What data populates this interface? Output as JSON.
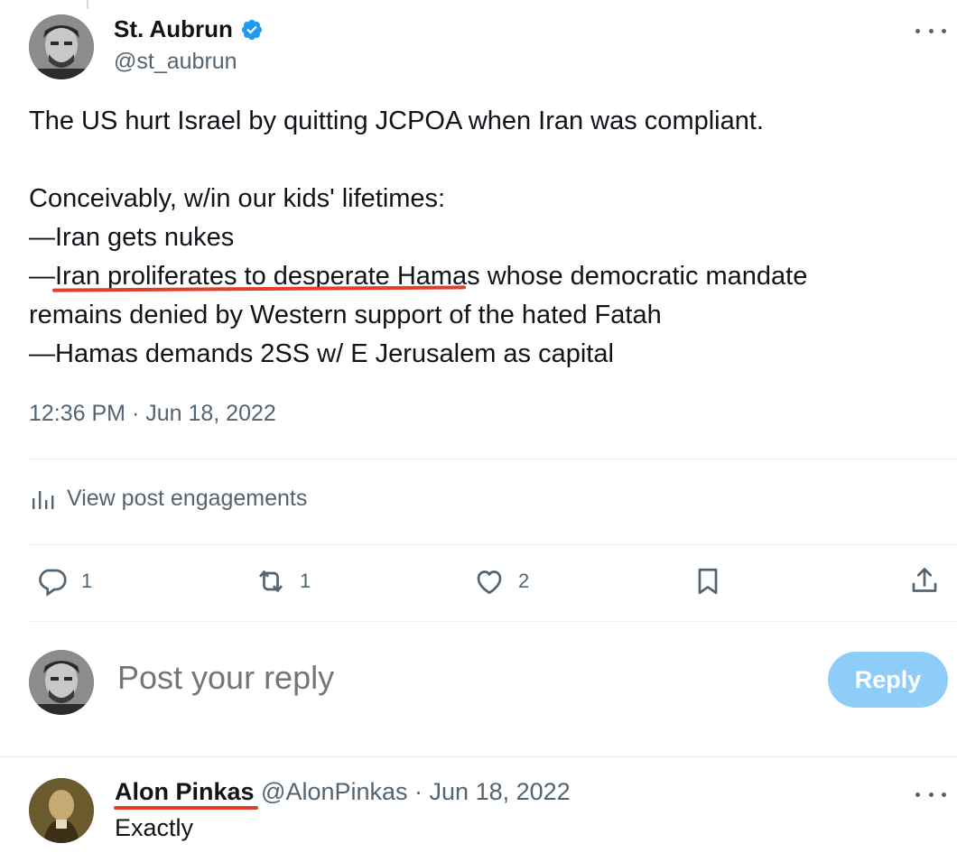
{
  "tweet": {
    "author": {
      "display_name": "St. Aubrun",
      "handle": "@st_aubrun",
      "verified": true
    },
    "text_lines": [
      "The US hurt Israel by quitting JCPOA when Iran was compliant.",
      "",
      "Conceivably, w/in our kids' lifetimes:",
      "—Iran gets nukes",
      "—Iran proliferates to desperate Hamas whose democratic mandate",
      "remains denied by Western support of the hated Fatah",
      "—Hamas demands 2SS w/ E Jerusalem as capital"
    ],
    "timestamp": "12:36 PM · Jun 18, 2022",
    "engagements_label": "View post engagements",
    "actions": {
      "reply_count": "1",
      "retweet_count": "1",
      "like_count": "2"
    }
  },
  "composer": {
    "placeholder": "Post your reply",
    "reply_button_label": "Reply"
  },
  "reply": {
    "display_name": "Alon Pinkas",
    "meta": " @AlonPinkas · Jun 18, 2022",
    "text": "Exactly"
  },
  "colors": {
    "text_primary": "#0f1419",
    "text_secondary": "#536471",
    "verified_blue": "#1d9bf0",
    "reply_button_disabled": "#8ecdf8",
    "annotation_underline": "#e0402a"
  },
  "icons": {
    "verified": "verified-badge-icon",
    "more": "more-dots-icon",
    "engagements": "bar-chart-icon",
    "reply": "reply-bubble-icon",
    "retweet": "retweet-icon",
    "like": "heart-icon",
    "bookmark": "bookmark-icon",
    "share": "share-icon"
  }
}
